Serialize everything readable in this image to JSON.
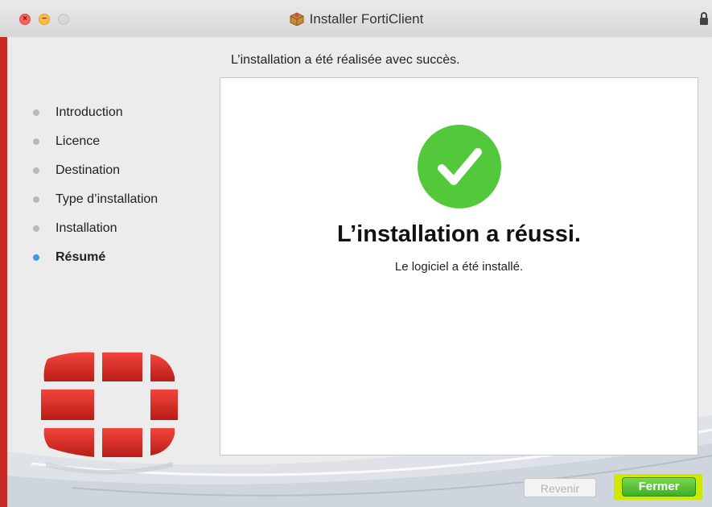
{
  "window": {
    "title": "Installer FortiClient",
    "title_icon": "package-icon",
    "accent_color": "#3d9af3"
  },
  "header": {
    "message": "L’installation a été réalisée avec succès."
  },
  "steps": [
    {
      "label": "Introduction",
      "state": "done"
    },
    {
      "label": "Licence",
      "state": "done"
    },
    {
      "label": "Destination",
      "state": "done"
    },
    {
      "label": "Type d’installation",
      "state": "done"
    },
    {
      "label": "Installation",
      "state": "done"
    },
    {
      "label": "Résumé",
      "state": "current"
    }
  ],
  "result": {
    "icon": "checkmark-icon",
    "icon_color": "#54c83b",
    "title": "L’installation a réussi.",
    "subtitle": "Le logiciel a été installé."
  },
  "buttons": {
    "back_label": "Revenir",
    "back_enabled": false,
    "close_label": "Fermer"
  }
}
